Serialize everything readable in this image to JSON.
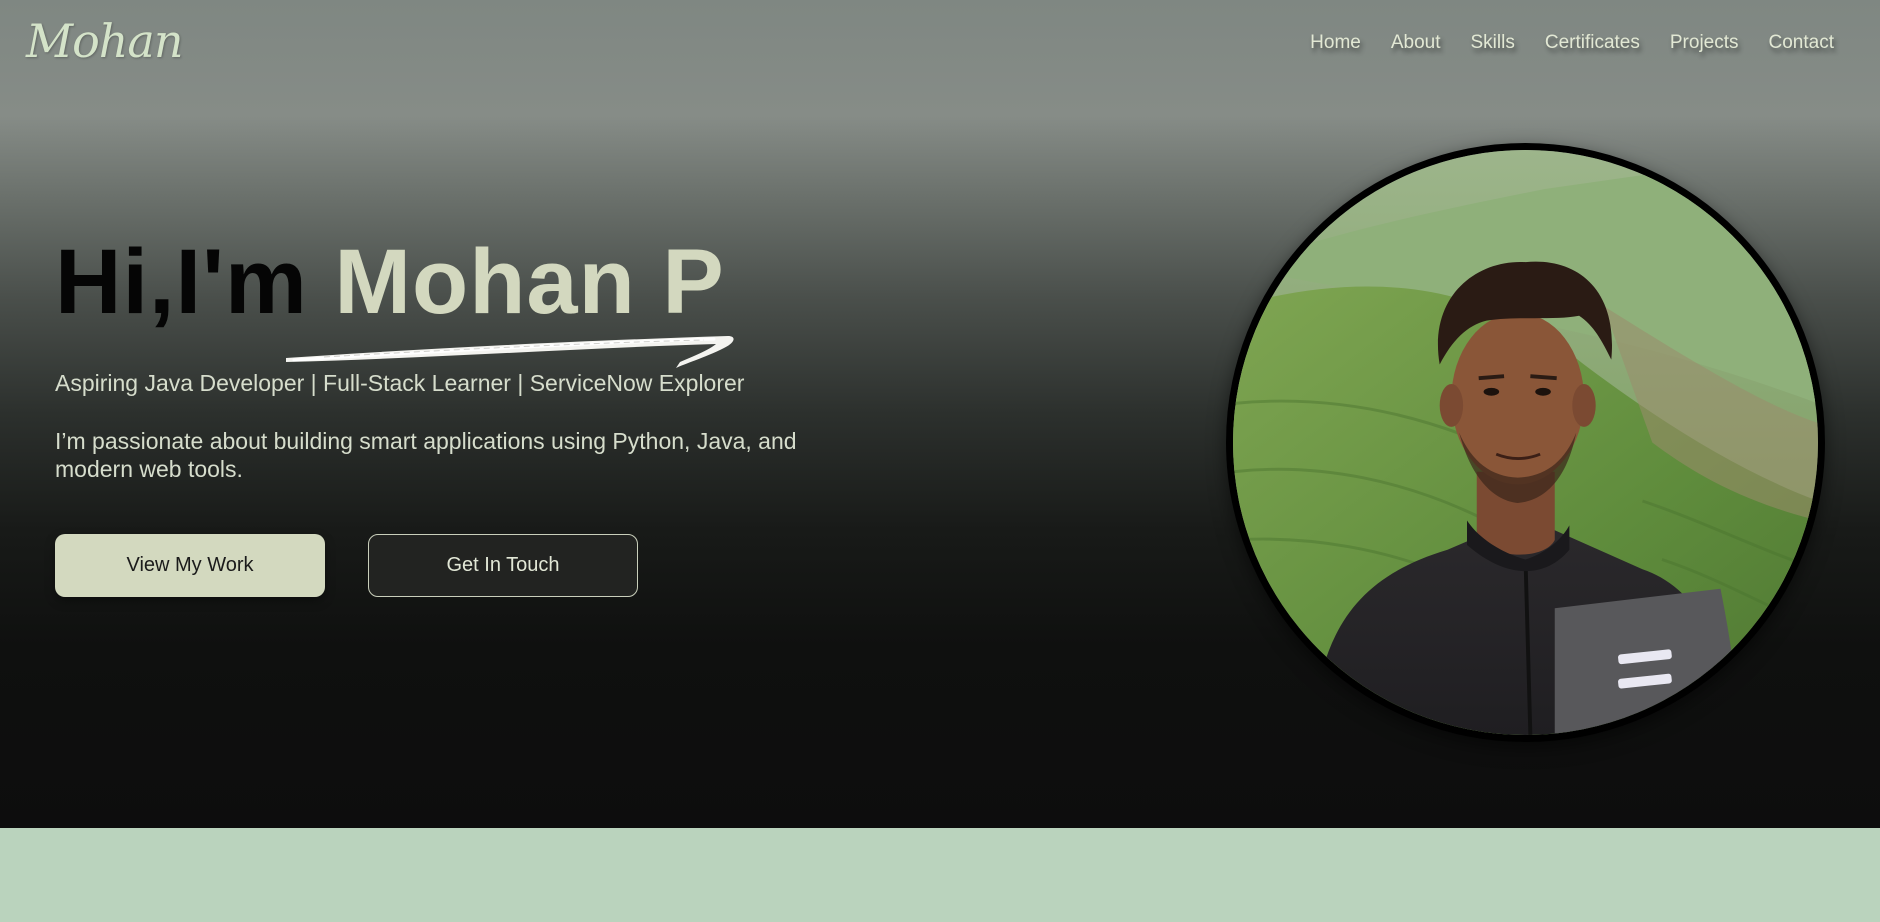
{
  "header": {
    "logo": "Mohan",
    "nav": [
      "Home",
      "About",
      "Skills",
      "Certificates",
      "Projects",
      "Contact"
    ]
  },
  "hero": {
    "greeting": "Hi,I'm",
    "name": "Mohan P",
    "tagline": "Aspiring Java Developer | Full-Stack Learner | ServiceNow Explorer",
    "description": "I’m passionate about building smart applications using Python, Java, and modern web tools.",
    "primary_button": "View My Work",
    "secondary_button": "Get In Touch"
  },
  "colors": {
    "accent": "#d3d9bf",
    "logo": "#d4e3c9",
    "section_bg": "#bad3bd",
    "hero_dark": "#0d0d0d"
  },
  "icons": {
    "underline": "brush-stroke-underline"
  }
}
